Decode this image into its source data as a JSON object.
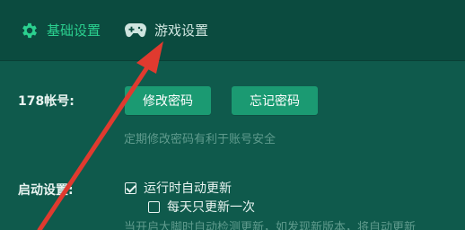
{
  "tabs": {
    "basic": {
      "label": "基础设置",
      "icon": "gear-icon",
      "active": true,
      "color": "#2bd08f"
    },
    "game": {
      "label": "游戏设置",
      "icon": "gamepad-icon",
      "active": false,
      "color": "#cfe5df"
    }
  },
  "account": {
    "label": "178帐号:",
    "change_password": "修改密码",
    "forgot_password": "忘记密码",
    "hint": "定期修改密码有利于账号安全"
  },
  "startup": {
    "label": "启动设置:",
    "auto_update": {
      "label": "运行时自动更新",
      "checked": true
    },
    "daily_update": {
      "label": "每天只更新一次",
      "checked": false
    },
    "hint": "当开启大脚时自动检测更新，如发现新版本，将自动更新"
  },
  "annotation": {
    "type": "red-arrow",
    "color": "#e03a2f",
    "points_to": "tab-game"
  },
  "colors": {
    "background": "#0f5a4c",
    "tabbar": "#0b4b3f",
    "button": "#1b9a72",
    "hint": "#5f9b8d"
  }
}
